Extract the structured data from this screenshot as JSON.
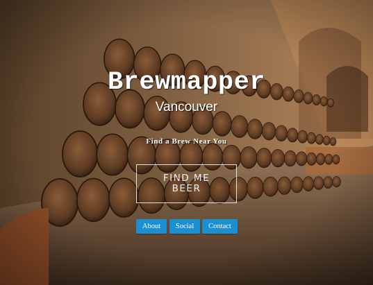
{
  "hero": {
    "title": "Brewmapper",
    "city": "Vancouver",
    "tagline": "Find a Brew Near You",
    "cta_line1": "FIND ME",
    "cta_line2": "BEER"
  },
  "nav": {
    "about": "About",
    "social": "Social",
    "contact": "Contact"
  },
  "colors": {
    "nav_button": "#1c8fd1",
    "text": "#ffffff"
  }
}
